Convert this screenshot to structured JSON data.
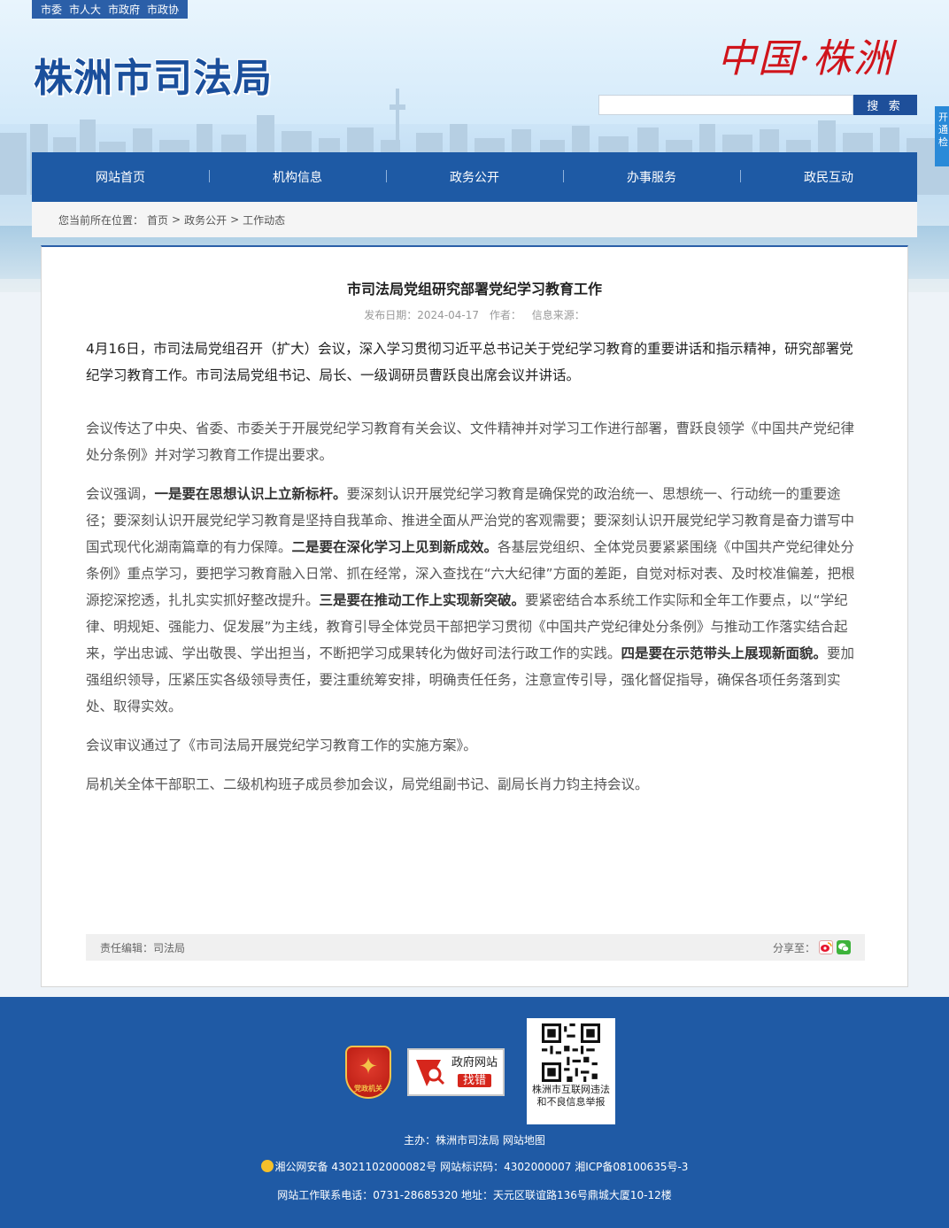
{
  "topbar": {
    "links": [
      "市委",
      "市人大",
      "市政府",
      "市政协"
    ]
  },
  "header": {
    "site_title": "株洲市司法局",
    "city_logo": "中国·株洲",
    "search_placeholder": "",
    "search_label": "搜 索",
    "side_tab": "开通检"
  },
  "nav": {
    "items": [
      "网站首页",
      "机构信息",
      "政务公开",
      "办事服务",
      "政民互动"
    ]
  },
  "breadcrumb": {
    "prefix": "您当前所在位置：",
    "items": [
      "首页",
      "政务公开",
      "工作动态"
    ],
    "separator": ">"
  },
  "article": {
    "title": "市司法局党组研究部署党纪学习教育工作",
    "meta_date_label": "发布日期：",
    "meta_date": "2024-04-17",
    "meta_author_label": "作者：",
    "meta_source_label": "信息来源：",
    "lead": "4月16日，市司法局党组召开（扩大）会议，深入学习贯彻习近平总书记关于党纪学习教育的重要讲话和指示精神，研究部署党纪学习教育工作。市司法局党组书记、局长、一级调研员曹跃良出席会议并讲话。",
    "p1": "会议传达了中央、省委、市委关于开展党纪学习教育有关会议、文件精神并对学习工作进行部署，曹跃良领学《中国共产党纪律处分条例》并对学习教育工作提出要求。",
    "p2_a": "会议强调，",
    "p2_b1": "一是要在思想认识上立新标杆。",
    "p2_c": "要深刻认识开展党纪学习教育是确保党的政治统一、思想统一、行动统一的重要途径；要深刻认识开展党纪学习教育是坚持自我革命、推进全面从严治党的客观需要；要深刻认识开展党纪学习教育是奋力谱写中国式现代化湖南篇章的有力保障。",
    "p2_b2": "二是要在深化学习上见到新成效。",
    "p2_d": "各基层党组织、全体党员要紧紧围绕《中国共产党纪律处分条例》重点学习，要把学习教育融入日常、抓在经常，深入查找在“六大纪律”方面的差距，自觉对标对表、及时校准偏差，把根源挖深挖透，扎扎实实抓好整改提升。",
    "p2_b3": "三是要在推动工作上实现新突破。",
    "p2_e": "要紧密结合本系统工作实际和全年工作要点，以“学纪律、明规矩、强能力、促发展”为主线，教育引导全体党员干部把学习贯彻《中国共产党纪律处分条例》与推动工作落实结合起来，学出忠诚、学出敬畏、学出担当，不断把学习成果转化为做好司法行政工作的实践。",
    "p2_b4": "四是要在示范带头上展现新面貌。",
    "p2_f": "要加强组织领导，压紧压实各级领导责任，要注重统筹安排，明确责任任务，注意宣传引导，强化督促指导，确保各项任务落到实处、取得实效。",
    "p3": "会议审议通过了《市司法局开展党纪学习教育工作的实施方案》。",
    "p4": "局机关全体干部职工、二级机构班子成员参加会议，局党组副书记、副局长肖力钧主持会议。",
    "editor_label": "责任编辑：",
    "editor": "司法局",
    "share_label": "分享至："
  },
  "footer": {
    "badge_text": "党政机关",
    "gov_find_line1": "政府网站",
    "gov_find_line2": "找错",
    "qr_caption_1": "株洲市互联网违法",
    "qr_caption_2": "和不良信息举报",
    "host": "主办：株洲市司法局  网站地图",
    "record": "湘公网安备 43021102000082号  网站标识码：4302000007  湘ICP备08100635号-3",
    "contact": "网站工作联系电话：0731-28685320  地址：天元区联谊路136号鼎城大厦10-12楼"
  },
  "colors": {
    "nav": "#1e5aa5",
    "footer": "#1f5aa5",
    "accent_red": "#d0141b"
  }
}
